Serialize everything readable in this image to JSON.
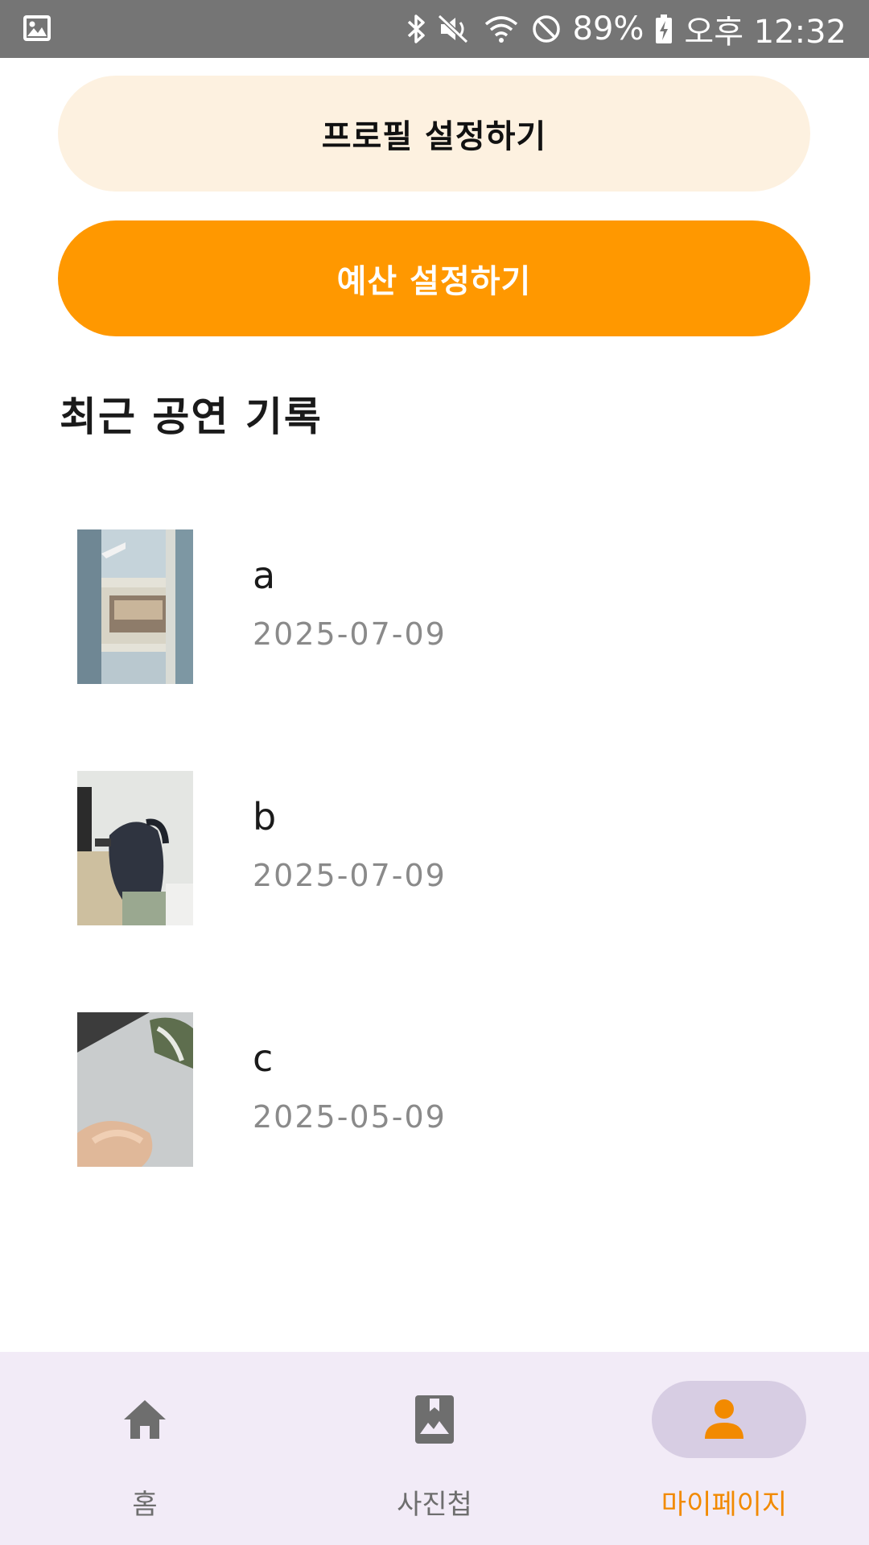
{
  "status_bar": {
    "battery": "89%",
    "time": "오후 12:32",
    "icons": [
      "gallery-icon",
      "bluetooth-icon",
      "mute-icon",
      "wifi-icon",
      "do-not-disturb-icon",
      "battery-charging-icon"
    ]
  },
  "buttons": {
    "profile_label": "프로필 설정하기",
    "budget_label": "예산 설정하기"
  },
  "section": {
    "title": "최근 공연 기록"
  },
  "records": [
    {
      "name": "a",
      "date": "2025-07-09"
    },
    {
      "name": "b",
      "date": "2025-07-09"
    },
    {
      "name": "c",
      "date": "2025-05-09"
    }
  ],
  "bottom_nav": {
    "items": [
      {
        "label": "홈",
        "icon": "home-icon",
        "active": false
      },
      {
        "label": "사진첩",
        "icon": "photo-album-icon",
        "active": false
      },
      {
        "label": "마이페이지",
        "icon": "person-icon",
        "active": true
      }
    ]
  },
  "colors": {
    "accent": "#ff9800",
    "profile_button_bg": "#fdf1e0",
    "nav_bg": "#f2ebf7",
    "nav_active_pill": "#d7cde3",
    "nav_active_label": "#f28a00",
    "status_bar_bg": "#757575"
  }
}
